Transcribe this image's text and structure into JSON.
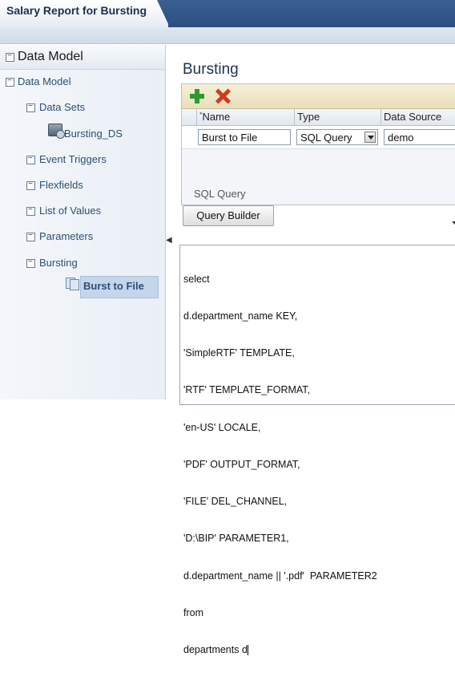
{
  "report_title": "Salary Report for Bursting",
  "left_panel": {
    "header": "Data Model",
    "tree": [
      {
        "label": "Data Model",
        "level": 0,
        "toggle": true
      },
      {
        "label": "Data Sets",
        "level": 1,
        "toggle": true
      },
      {
        "label": "Bursting_DS",
        "level": 2,
        "toggle": false,
        "icon": "dataset-icon"
      },
      {
        "label": "Event Triggers",
        "level": 1,
        "toggle": true
      },
      {
        "label": "Flexfields",
        "level": 1,
        "toggle": true
      },
      {
        "label": "List of Values",
        "level": 1,
        "toggle": true
      },
      {
        "label": "Parameters",
        "level": 1,
        "toggle": true
      },
      {
        "label": "Bursting",
        "level": 1,
        "toggle": true
      },
      {
        "label": "Burst to File",
        "level": 2,
        "toggle": false,
        "icon": "bursting-definition-icon",
        "selected": true
      }
    ]
  },
  "main": {
    "title": "Bursting",
    "table": {
      "columns": [
        "Name",
        "Type",
        "Data Source"
      ],
      "rows": [
        {
          "name": "Burst to File",
          "type": "SQL Query",
          "data_source": "demo"
        }
      ]
    },
    "sql_label": "SQL Query",
    "query_builder_label": "Query Builder",
    "sql_lines": [
      "select",
      "d.department_name KEY,",
      "'SimpleRTF' TEMPLATE,",
      "'RTF' TEMPLATE_FORMAT,",
      "'en-US' LOCALE,",
      "'PDF' OUTPUT_FORMAT,",
      "'FILE' DEL_CHANNEL,",
      "'D:\\BIP' PARAMETER1,",
      "d.department_name || '.pdf'  PARAMETER2",
      "from",
      "departments d"
    ]
  },
  "colors": {
    "banner": "#294c7f",
    "tree_text": "#2f4e78",
    "selected_bg": "#c6d6ea",
    "add": "#2e9a2e",
    "delete": "#d23a1f"
  }
}
